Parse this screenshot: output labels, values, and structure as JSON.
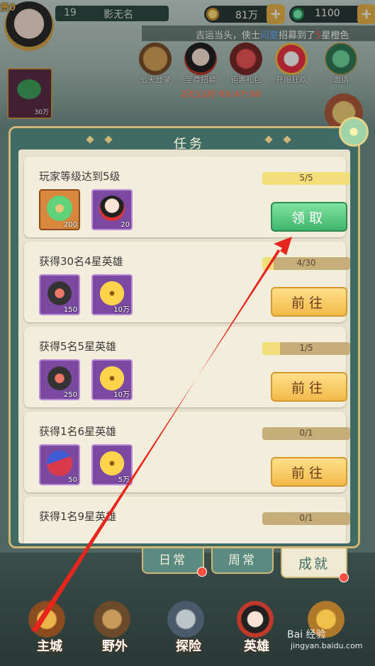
{
  "hud": {
    "vip": "贵0",
    "level": "19",
    "player_name": "影无名",
    "coins": "81万",
    "gems": "1100"
  },
  "marquee": {
    "prefix": "吉运当头，侠士",
    "name": "问夏",
    "mid": "招募到了",
    "num": "5",
    "suffix": "星橙色"
  },
  "events": [
    {
      "label": "七天登录"
    },
    {
      "label": "至尊招募"
    },
    {
      "label": "钜惠礼包"
    },
    {
      "label": "开服狂欢"
    },
    {
      "label": "邀请"
    }
  ],
  "timer": "2天11时 03:47:50",
  "shop_tile_label": "30万",
  "panel": {
    "title": "任务",
    "tasks": [
      {
        "name": "玩家等级达到5级",
        "progress": "5/5",
        "progress_fraction": 1.0,
        "button": "领取",
        "button_style": "green",
        "rewards": [
          {
            "pic": "jade",
            "qty": "200",
            "frame": "orange"
          },
          {
            "pic": "hero",
            "qty": "20",
            "frame": "purple"
          }
        ]
      },
      {
        "name": "获得30名4星英雄",
        "progress": "4/30",
        "progress_fraction": 0.13,
        "button": "前往",
        "button_style": "yellow",
        "rewards": [
          {
            "pic": "hex",
            "qty": "150",
            "frame": "purple"
          },
          {
            "pic": "coin",
            "qty": "10万",
            "frame": "purple"
          }
        ]
      },
      {
        "name": "获得5名5星英雄",
        "progress": "1/5",
        "progress_fraction": 0.2,
        "button": "前往",
        "button_style": "yellow",
        "rewards": [
          {
            "pic": "hex",
            "qty": "250",
            "frame": "purple"
          },
          {
            "pic": "coin",
            "qty": "10万",
            "frame": "purple"
          }
        ]
      },
      {
        "name": "获得1名6星英雄",
        "progress": "0/1",
        "progress_fraction": 0.0,
        "button": "前往",
        "button_style": "yellow",
        "rewards": [
          {
            "pic": "bag",
            "qty": "50",
            "frame": "purple"
          },
          {
            "pic": "coin",
            "qty": "5万",
            "frame": "purple"
          }
        ]
      },
      {
        "name": "获得1名9星英雄",
        "progress": "0/1",
        "progress_fraction": 0.0,
        "button": "",
        "button_style": "yellow",
        "rewards": []
      }
    ]
  },
  "tabs": [
    {
      "label": "日常",
      "active": false,
      "dot": true
    },
    {
      "label": "周常",
      "active": false,
      "dot": false
    },
    {
      "label": "成就",
      "active": true,
      "dot": true
    }
  ],
  "nav": [
    {
      "label": "主城"
    },
    {
      "label": "野外"
    },
    {
      "label": "探险"
    },
    {
      "label": "英雄"
    }
  ],
  "watermark": {
    "line1": "Bai 经验",
    "line2": "jingyan.baidu.com"
  },
  "colors": {
    "panel": "#3f6b64",
    "accent_gold": "#cfb677",
    "green_btn": "#3fb56d",
    "yellow_btn": "#f2b94a",
    "arrow_red": "#e8251c"
  }
}
